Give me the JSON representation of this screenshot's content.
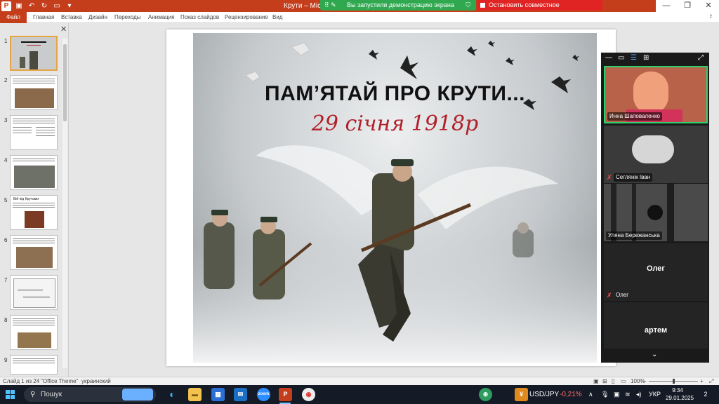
{
  "titlebar": {
    "doc_title": "Крути – Mic",
    "share_banner": "Вы запустили демонстрацию экрана",
    "stop_banner": "Остановить совместное использование",
    "controls": [
      "—",
      "❐",
      "✕"
    ]
  },
  "ribbon": {
    "tabs": [
      "Файл",
      "Главная",
      "Вставка",
      "Дизайн",
      "Переходы",
      "Анимация",
      "Показ слайдов",
      "Рецензирование",
      "Вид"
    ]
  },
  "thumbnails": {
    "numbers": [
      "1",
      "2",
      "3",
      "4",
      "5",
      "6",
      "7",
      "8",
      "9"
    ],
    "slide5_title": "Бій під Крутами"
  },
  "slide": {
    "title": "ПАМ’ЯТАЙ ПРО КРУТИ...",
    "date": "29 січня 1918р"
  },
  "video_panel": {
    "tiles": [
      {
        "name": "Инна Шаповаленко"
      },
      {
        "name": "Сеглянік Іван"
      },
      {
        "name": "Уляна Бережанська"
      },
      {
        "center": "Олег",
        "name": "Олег"
      },
      {
        "center": "артем"
      }
    ]
  },
  "statusbar": {
    "slide_info": "Слайд 1 из 24",
    "theme": "\"Office Theme\"",
    "language": "украинский",
    "zoom": "100%"
  },
  "taskbar": {
    "search": "Пошук",
    "ticker_symbol": "USD/JPY",
    "ticker_change": "-0,21%",
    "lang": "УКР",
    "time": "9:34",
    "date": "29.01.2025",
    "notifications": "2"
  }
}
